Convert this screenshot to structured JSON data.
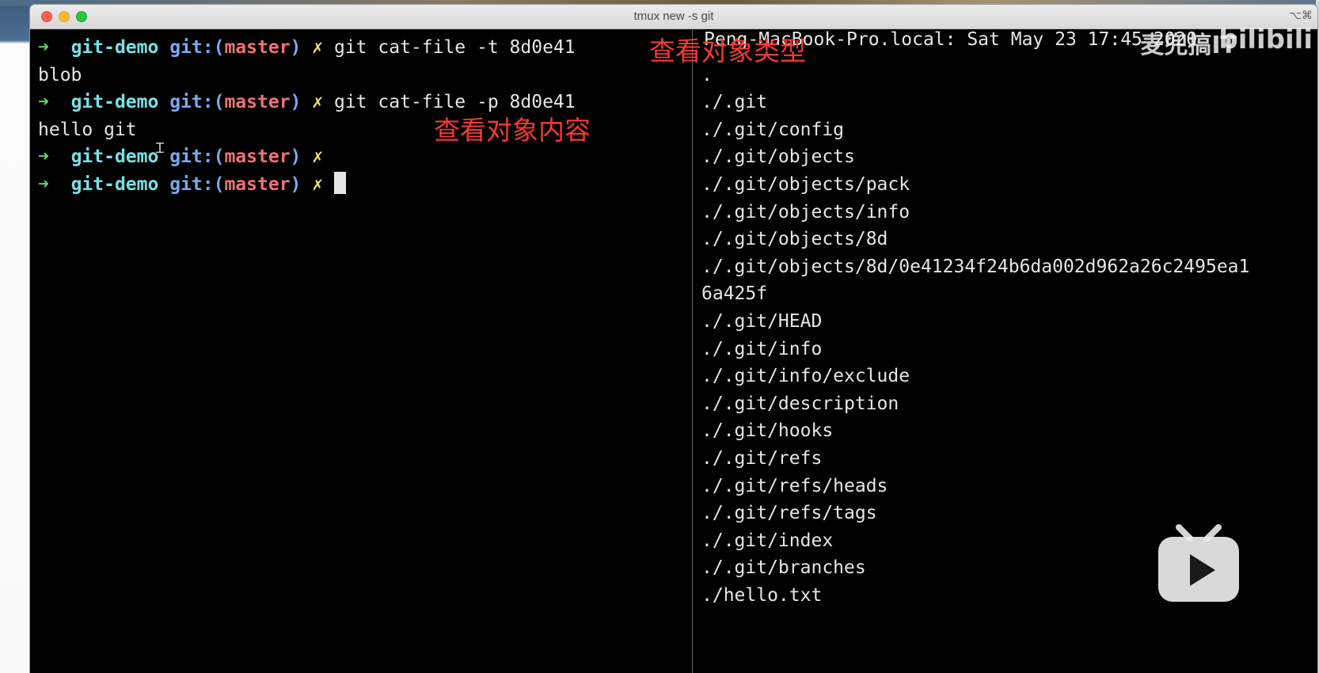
{
  "window": {
    "title": "tmux new -s git",
    "shortcut": "⌥⌘"
  },
  "left_pane": {
    "lines": [
      {
        "type": "prompt",
        "arrow": "➜",
        "dir": "git-demo",
        "git": "git:(",
        "branch": "master",
        "close": ")",
        "dirty": "✗",
        "cmd": "git cat-file -t 8d0e41"
      },
      {
        "type": "output",
        "text": "blob"
      },
      {
        "type": "prompt",
        "arrow": "➜",
        "dir": "git-demo",
        "git": "git:(",
        "branch": "master",
        "close": ")",
        "dirty": "✗",
        "cmd": "git cat-file -p 8d0e41"
      },
      {
        "type": "output",
        "text": "hello git"
      },
      {
        "type": "prompt",
        "arrow": "➜",
        "dir": "git-demo",
        "git": "git:(",
        "branch": "master",
        "close": ")",
        "dirty": "✗",
        "cmd": ""
      },
      {
        "type": "prompt",
        "arrow": "➜",
        "dir": "git-demo",
        "git": "git:(",
        "branch": "master",
        "close": ")",
        "dirty": "✗",
        "cmd": "",
        "cursor": true
      }
    ]
  },
  "annotations": {
    "type_label": "查看对象类型",
    "content_label": "查看对象内容"
  },
  "right_pane": {
    "status_line": "Peng-MacBook-Pro.local: Sat May 23 17:45 2020",
    "lines": [
      "",
      ".",
      "./.git",
      "./.git/config",
      "./.git/objects",
      "./.git/objects/pack",
      "./.git/objects/info",
      "./.git/objects/8d",
      "./.git/objects/8d/0e41234f24b6da002d962a26c2495ea1",
      "6a425f",
      "./.git/HEAD",
      "./.git/info",
      "./.git/info/exclude",
      "./.git/description",
      "./.git/hooks",
      "./.git/refs",
      "./.git/refs/heads",
      "./.git/refs/tags",
      "./.git/index",
      "./.git/branches",
      "./hello.txt"
    ]
  },
  "overlay": {
    "watermark": "麦兜搞IT",
    "logo_text": "bilibili",
    "play_icon": "bilibili-tv-play-icon"
  }
}
